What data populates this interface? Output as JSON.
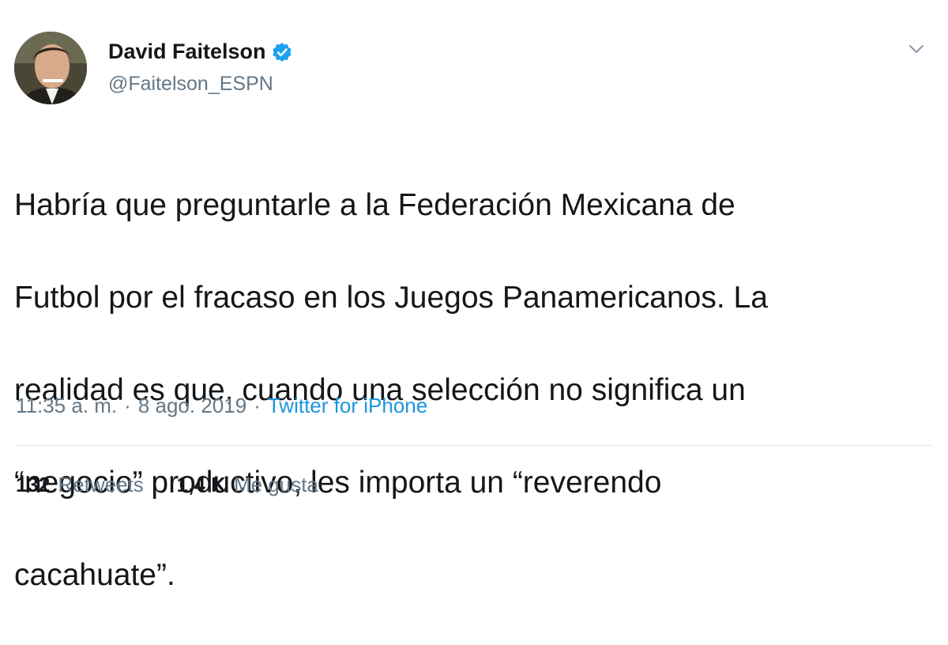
{
  "author": {
    "name": "David Faitelson",
    "handle": "@Faitelson_ESPN",
    "verified": true,
    "accent_color": "#1da1f2"
  },
  "tweet": {
    "text_lines": [
      "Habría que preguntarle a la Federación Mexicana de",
      "Futbol por el fracaso en los Juegos Panamericanos. La",
      "realidad es que, cuando una selección no significa un",
      "“negocio” productivo, les importa un “reverendo",
      "cacahuate”."
    ],
    "time": "11:35 a. m.",
    "date": "8 ago. 2019",
    "separator": "·",
    "source": "Twitter for iPhone"
  },
  "stats": {
    "retweets_count": "132",
    "retweets_label": "Retweets",
    "likes_count": "1,4 K",
    "likes_label": "Me gusta"
  },
  "icons": {
    "verified": "verified-badge-icon",
    "menu": "chevron-down-icon"
  }
}
